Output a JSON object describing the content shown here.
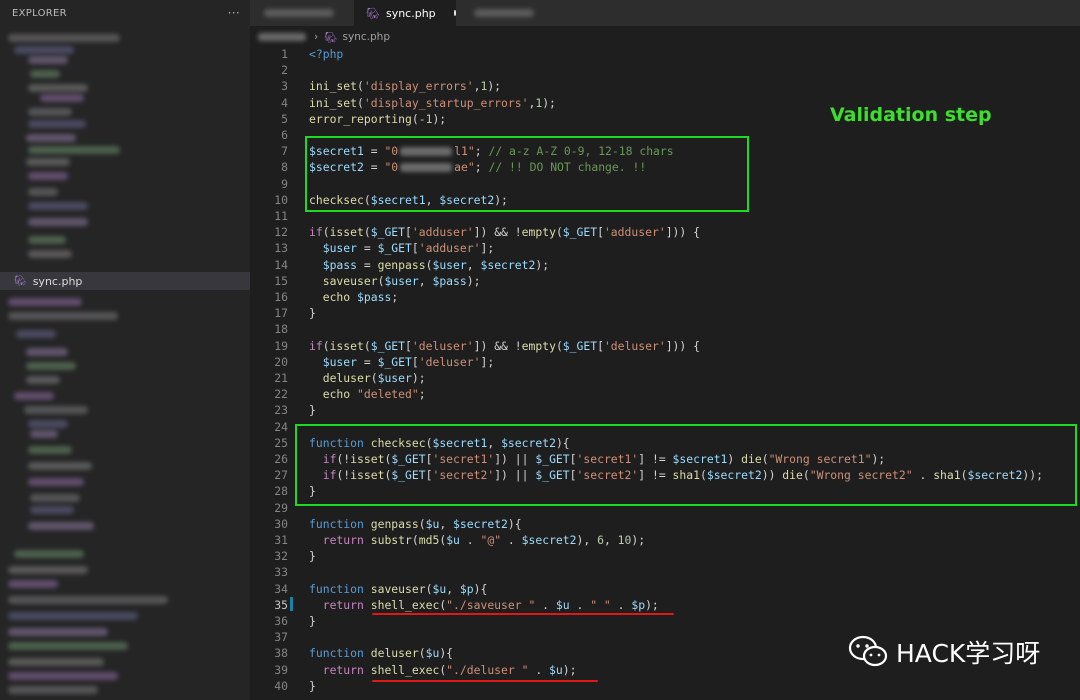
{
  "sidebar": {
    "title": "EXPLORER",
    "more_label": "···",
    "selected_file": "sync.php"
  },
  "tabs": [
    {
      "label": "sync.php",
      "active": true,
      "modified": true
    }
  ],
  "breadcrumb": {
    "separator": "›",
    "file": "sync.php"
  },
  "annotation": {
    "label": "Validation step"
  },
  "watermark": {
    "text": "HACK学习呀"
  },
  "code": {
    "lines": [
      {
        "n": "1",
        "t": [
          [
            "kw",
            "<?php"
          ]
        ]
      },
      {
        "n": "2",
        "t": []
      },
      {
        "n": "3",
        "t": [
          [
            "fn",
            "ini_set"
          ],
          [
            "op",
            "("
          ],
          [
            "str",
            "'display_errors'"
          ],
          [
            "op",
            ","
          ],
          [
            "num",
            "1"
          ],
          [
            "op",
            ");"
          ]
        ]
      },
      {
        "n": "4",
        "t": [
          [
            "fn",
            "ini_set"
          ],
          [
            "op",
            "("
          ],
          [
            "str",
            "'display_startup_errors'"
          ],
          [
            "op",
            ","
          ],
          [
            "num",
            "1"
          ],
          [
            "op",
            ");"
          ]
        ]
      },
      {
        "n": "5",
        "t": [
          [
            "fn",
            "error_reporting"
          ],
          [
            "op",
            "("
          ],
          [
            "num",
            "-1"
          ],
          [
            "op",
            ");"
          ]
        ]
      },
      {
        "n": "6",
        "t": []
      },
      {
        "n": "7",
        "t": [
          [
            "var",
            "$secret1"
          ],
          [
            "op",
            " = "
          ],
          [
            "str",
            "\"0"
          ],
          [
            "redact",
            ""
          ],
          [
            "str",
            "l1\""
          ],
          [
            "op",
            "; "
          ],
          [
            "cm",
            "// a-z A-Z 0-9, 12-18 chars"
          ]
        ]
      },
      {
        "n": "8",
        "t": [
          [
            "var",
            "$secret2"
          ],
          [
            "op",
            " = "
          ],
          [
            "str",
            "\"0"
          ],
          [
            "redact",
            ""
          ],
          [
            "str",
            "ae\""
          ],
          [
            "op",
            "; "
          ],
          [
            "cm",
            "// !! DO NOT change. !!"
          ]
        ]
      },
      {
        "n": "9",
        "t": []
      },
      {
        "n": "10",
        "t": [
          [
            "fn",
            "checksec"
          ],
          [
            "op",
            "("
          ],
          [
            "var",
            "$secret1"
          ],
          [
            "op",
            ", "
          ],
          [
            "var",
            "$secret2"
          ],
          [
            "op",
            ");"
          ]
        ]
      },
      {
        "n": "11",
        "t": []
      },
      {
        "n": "12",
        "t": [
          [
            "ctl",
            "if"
          ],
          [
            "op",
            "("
          ],
          [
            "fn",
            "isset"
          ],
          [
            "op",
            "("
          ],
          [
            "var",
            "$_GET"
          ],
          [
            "op",
            "["
          ],
          [
            "str",
            "'adduser'"
          ],
          [
            "op",
            "]) && !"
          ],
          [
            "fn",
            "empty"
          ],
          [
            "op",
            "("
          ],
          [
            "var",
            "$_GET"
          ],
          [
            "op",
            "["
          ],
          [
            "str",
            "'adduser'"
          ],
          [
            "op",
            "])) {"
          ]
        ]
      },
      {
        "n": "13",
        "t": [
          [
            "op",
            "  "
          ],
          [
            "var",
            "$user"
          ],
          [
            "op",
            " = "
          ],
          [
            "var",
            "$_GET"
          ],
          [
            "op",
            "["
          ],
          [
            "str",
            "'adduser'"
          ],
          [
            "op",
            "];"
          ]
        ]
      },
      {
        "n": "14",
        "t": [
          [
            "op",
            "  "
          ],
          [
            "var",
            "$pass"
          ],
          [
            "op",
            " = "
          ],
          [
            "fn",
            "genpass"
          ],
          [
            "op",
            "("
          ],
          [
            "var",
            "$user"
          ],
          [
            "op",
            ", "
          ],
          [
            "var",
            "$secret2"
          ],
          [
            "op",
            ");"
          ]
        ]
      },
      {
        "n": "15",
        "t": [
          [
            "op",
            "  "
          ],
          [
            "fn",
            "saveuser"
          ],
          [
            "op",
            "("
          ],
          [
            "var",
            "$user"
          ],
          [
            "op",
            ", "
          ],
          [
            "var",
            "$pass"
          ],
          [
            "op",
            ");"
          ]
        ]
      },
      {
        "n": "16",
        "t": [
          [
            "op",
            "  "
          ],
          [
            "fn",
            "echo"
          ],
          [
            "op",
            " "
          ],
          [
            "var",
            "$pass"
          ],
          [
            "op",
            ";"
          ]
        ]
      },
      {
        "n": "17",
        "t": [
          [
            "op",
            "}"
          ]
        ]
      },
      {
        "n": "18",
        "t": []
      },
      {
        "n": "19",
        "t": [
          [
            "ctl",
            "if"
          ],
          [
            "op",
            "("
          ],
          [
            "fn",
            "isset"
          ],
          [
            "op",
            "("
          ],
          [
            "var",
            "$_GET"
          ],
          [
            "op",
            "["
          ],
          [
            "str",
            "'deluser'"
          ],
          [
            "op",
            "]) && !"
          ],
          [
            "fn",
            "empty"
          ],
          [
            "op",
            "("
          ],
          [
            "var",
            "$_GET"
          ],
          [
            "op",
            "["
          ],
          [
            "str",
            "'deluser'"
          ],
          [
            "op",
            "])) {"
          ]
        ]
      },
      {
        "n": "20",
        "t": [
          [
            "op",
            "  "
          ],
          [
            "var",
            "$user"
          ],
          [
            "op",
            " = "
          ],
          [
            "var",
            "$_GET"
          ],
          [
            "op",
            "["
          ],
          [
            "str",
            "'deluser'"
          ],
          [
            "op",
            "];"
          ]
        ]
      },
      {
        "n": "21",
        "t": [
          [
            "op",
            "  "
          ],
          [
            "fn",
            "deluser"
          ],
          [
            "op",
            "("
          ],
          [
            "var",
            "$user"
          ],
          [
            "op",
            ");"
          ]
        ]
      },
      {
        "n": "22",
        "t": [
          [
            "op",
            "  "
          ],
          [
            "fn",
            "echo"
          ],
          [
            "op",
            " "
          ],
          [
            "str",
            "\"deleted\""
          ],
          [
            "op",
            ";"
          ]
        ]
      },
      {
        "n": "23",
        "t": [
          [
            "op",
            "}"
          ]
        ]
      },
      {
        "n": "24",
        "t": []
      },
      {
        "n": "25",
        "t": [
          [
            "kw",
            "function"
          ],
          [
            "op",
            " "
          ],
          [
            "fn",
            "checksec"
          ],
          [
            "op",
            "("
          ],
          [
            "var",
            "$secret1"
          ],
          [
            "op",
            ", "
          ],
          [
            "var",
            "$secret2"
          ],
          [
            "op",
            "){"
          ]
        ]
      },
      {
        "n": "26",
        "t": [
          [
            "op",
            "  "
          ],
          [
            "ctl",
            "if"
          ],
          [
            "op",
            "(!"
          ],
          [
            "fn",
            "isset"
          ],
          [
            "op",
            "("
          ],
          [
            "var",
            "$_GET"
          ],
          [
            "op",
            "["
          ],
          [
            "str",
            "'secret1'"
          ],
          [
            "op",
            "]) || "
          ],
          [
            "var",
            "$_GET"
          ],
          [
            "op",
            "["
          ],
          [
            "str",
            "'secret1'"
          ],
          [
            "op",
            "] != "
          ],
          [
            "var",
            "$secret1"
          ],
          [
            "op",
            ") "
          ],
          [
            "fn",
            "die"
          ],
          [
            "op",
            "("
          ],
          [
            "str",
            "\"Wrong secret1\""
          ],
          [
            "op",
            ");"
          ]
        ]
      },
      {
        "n": "27",
        "t": [
          [
            "op",
            "  "
          ],
          [
            "ctl",
            "if"
          ],
          [
            "op",
            "(!"
          ],
          [
            "fn",
            "isset"
          ],
          [
            "op",
            "("
          ],
          [
            "var",
            "$_GET"
          ],
          [
            "op",
            "["
          ],
          [
            "str",
            "'secret2'"
          ],
          [
            "op",
            "]) || "
          ],
          [
            "var",
            "$_GET"
          ],
          [
            "op",
            "["
          ],
          [
            "str",
            "'secret2'"
          ],
          [
            "op",
            "] != "
          ],
          [
            "fn",
            "sha1"
          ],
          [
            "op",
            "("
          ],
          [
            "var",
            "$secret2"
          ],
          [
            "op",
            ")) "
          ],
          [
            "fn",
            "die"
          ],
          [
            "op",
            "("
          ],
          [
            "str",
            "\"Wrong secret2\""
          ],
          [
            "op",
            " . "
          ],
          [
            "fn",
            "sha1"
          ],
          [
            "op",
            "("
          ],
          [
            "var",
            "$secret2"
          ],
          [
            "op",
            "));"
          ]
        ]
      },
      {
        "n": "28",
        "t": [
          [
            "op",
            "}"
          ]
        ]
      },
      {
        "n": "29",
        "t": []
      },
      {
        "n": "30",
        "t": [
          [
            "kw",
            "function"
          ],
          [
            "op",
            " "
          ],
          [
            "fn",
            "genpass"
          ],
          [
            "op",
            "("
          ],
          [
            "var",
            "$u"
          ],
          [
            "op",
            ", "
          ],
          [
            "var",
            "$secret2"
          ],
          [
            "op",
            "){"
          ]
        ]
      },
      {
        "n": "31",
        "t": [
          [
            "op",
            "  "
          ],
          [
            "ctl",
            "return"
          ],
          [
            "op",
            " "
          ],
          [
            "fn",
            "substr"
          ],
          [
            "op",
            "("
          ],
          [
            "fn",
            "md5"
          ],
          [
            "op",
            "("
          ],
          [
            "var",
            "$u"
          ],
          [
            "op",
            " . "
          ],
          [
            "str",
            "\"@\""
          ],
          [
            "op",
            " . "
          ],
          [
            "var",
            "$secret2"
          ],
          [
            "op",
            "), "
          ],
          [
            "num",
            "6"
          ],
          [
            "op",
            ", "
          ],
          [
            "num",
            "10"
          ],
          [
            "op",
            ");"
          ]
        ]
      },
      {
        "n": "32",
        "t": [
          [
            "op",
            "}"
          ]
        ]
      },
      {
        "n": "33",
        "t": []
      },
      {
        "n": "34",
        "t": [
          [
            "kw",
            "function"
          ],
          [
            "op",
            " "
          ],
          [
            "fn",
            "saveuser"
          ],
          [
            "op",
            "("
          ],
          [
            "var",
            "$u"
          ],
          [
            "op",
            ", "
          ],
          [
            "var",
            "$p"
          ],
          [
            "op",
            "){"
          ]
        ]
      },
      {
        "n": "35",
        "t": [
          [
            "op",
            "  "
          ],
          [
            "ctl",
            "return"
          ],
          [
            "op",
            " "
          ],
          [
            "fn",
            "shell_exec"
          ],
          [
            "op",
            "("
          ],
          [
            "str",
            "\"./saveuser \""
          ],
          [
            "op",
            " . "
          ],
          [
            "var",
            "$u"
          ],
          [
            "op",
            " . "
          ],
          [
            "str",
            "\" \""
          ],
          [
            "op",
            " . "
          ],
          [
            "var",
            "$p"
          ],
          [
            "op",
            ");"
          ]
        ]
      },
      {
        "n": "36",
        "t": [
          [
            "op",
            "}"
          ]
        ]
      },
      {
        "n": "37",
        "t": []
      },
      {
        "n": "38",
        "t": [
          [
            "kw",
            "function"
          ],
          [
            "op",
            " "
          ],
          [
            "fn",
            "deluser"
          ],
          [
            "op",
            "("
          ],
          [
            "var",
            "$u"
          ],
          [
            "op",
            "){"
          ]
        ]
      },
      {
        "n": "39",
        "t": [
          [
            "op",
            "  "
          ],
          [
            "ctl",
            "return"
          ],
          [
            "op",
            " "
          ],
          [
            "fn",
            "shell_exec"
          ],
          [
            "op",
            "("
          ],
          [
            "str",
            "\"./deluser \""
          ],
          [
            "op",
            " . "
          ],
          [
            "var",
            "$u"
          ],
          [
            "op",
            ");"
          ]
        ]
      },
      {
        "n": "40",
        "t": [
          [
            "op",
            "}"
          ]
        ]
      }
    ]
  }
}
